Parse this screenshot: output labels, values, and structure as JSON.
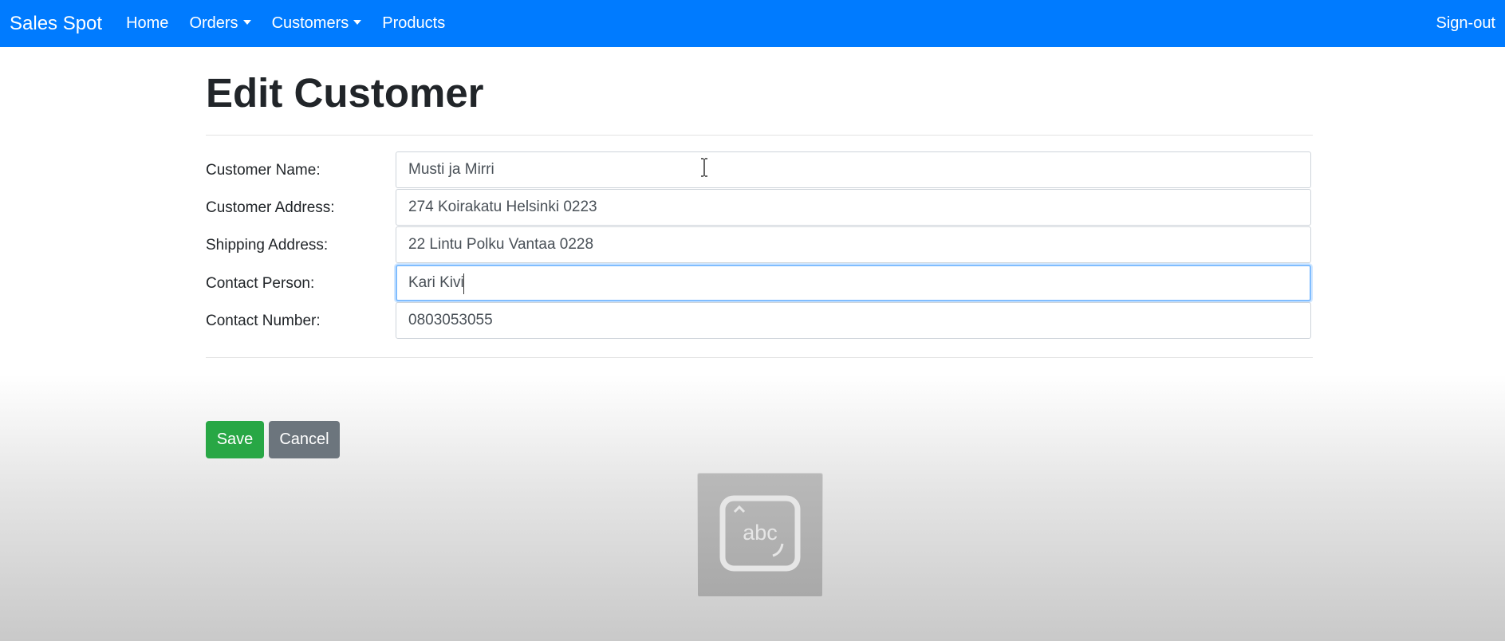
{
  "navbar": {
    "brand": "Sales Spot",
    "items": [
      {
        "label": "Home"
      },
      {
        "label": "Orders"
      },
      {
        "label": "Customers"
      },
      {
        "label": "Products"
      }
    ],
    "signout": "Sign-out"
  },
  "page": {
    "title": "Edit Customer"
  },
  "form": {
    "customer_name": {
      "label": "Customer Name:",
      "value": "Musti ja Mirri"
    },
    "customer_address": {
      "label": "Customer Address:",
      "value": "274 Koirakatu Helsinki 0223"
    },
    "shipping_address": {
      "label": "Shipping Address:",
      "value": "22 Lintu Polku Vantaa 0228"
    },
    "contact_person": {
      "label": "Contact Person:",
      "value": "Kari Kivi"
    },
    "contact_number": {
      "label": "Contact Number:",
      "value": "0803053055"
    }
  },
  "buttons": {
    "save": "Save",
    "cancel": "Cancel"
  },
  "keyboard_icon": {
    "text": "abc"
  },
  "colors": {
    "navbar": "#007bff",
    "save": "#28a745",
    "cancel": "#6c757d",
    "focus": "#80bdff"
  }
}
